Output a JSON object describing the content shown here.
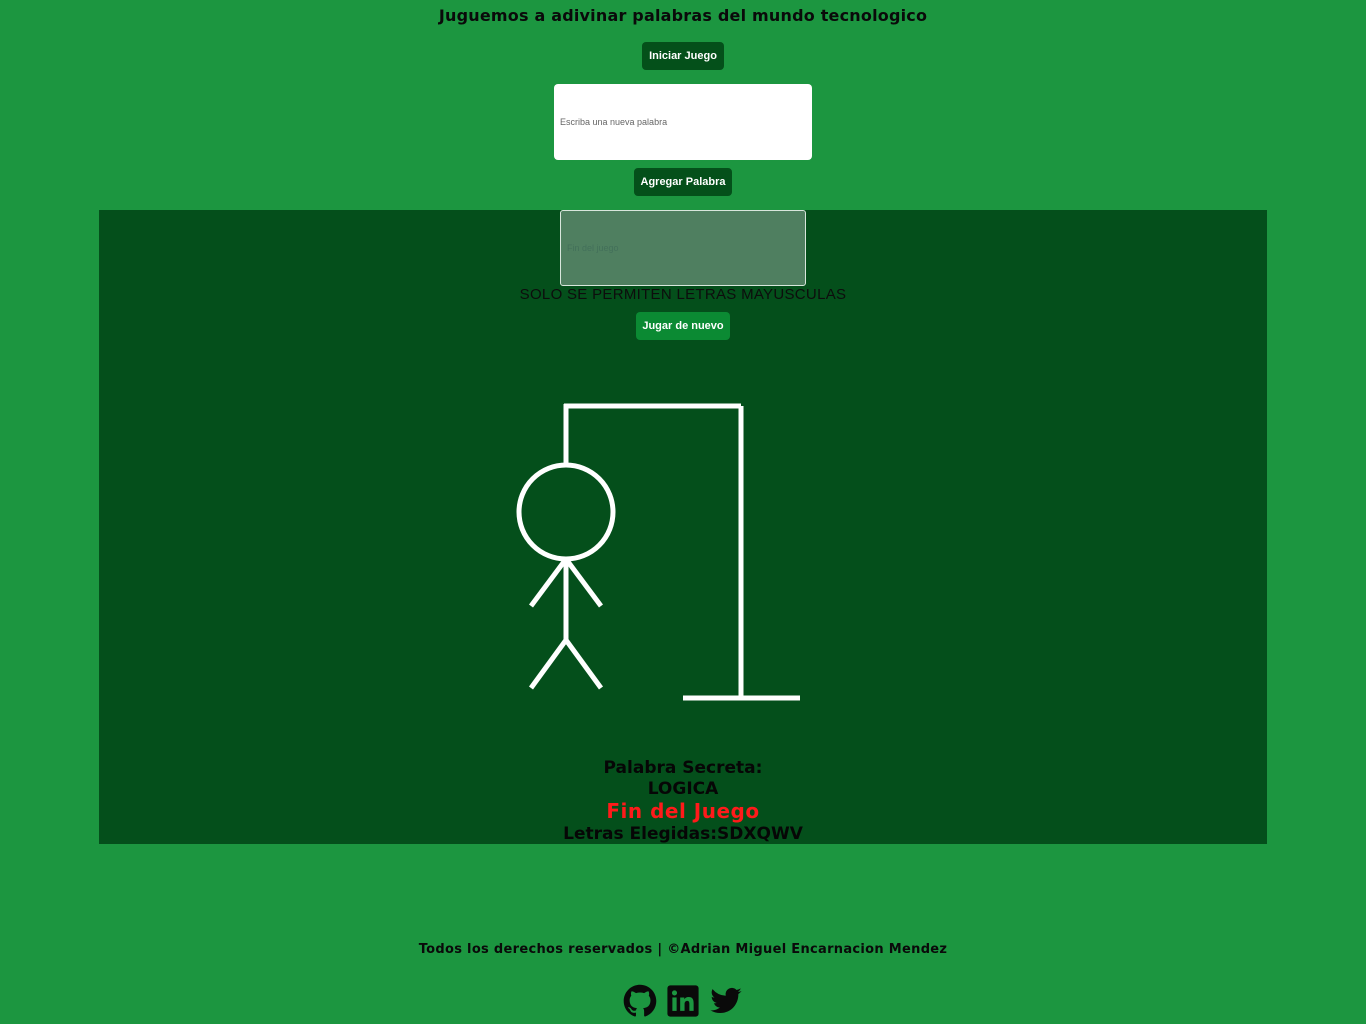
{
  "header": {
    "title": "Juguemos a adivinar palabras del mundo tecnologico"
  },
  "controls": {
    "start_label": "Iniciar Juego",
    "word_input_placeholder": "Escriba una nueva palabra",
    "add_label": "Agregar Palabra"
  },
  "game": {
    "letter_input_placeholder": "Fin del juego",
    "rule_note": "SOLO SE PERMITEN LETRAS MAYUSCULAS",
    "replay_label": "Jugar de nuevo",
    "secret_label": "Palabra Secreta:",
    "secret_word": "LOGICA",
    "status": "Fin del Juego",
    "chosen_letters": "Letras Elegidas:SDXQWV"
  },
  "footer": {
    "text": "Todos los derechos reservados | ©Adrian Miguel Encarnacion Mendez",
    "icons": [
      "github-icon",
      "linkedin-icon",
      "twitter-icon"
    ]
  },
  "colors": {
    "background": "#1c9640",
    "panel": "#044f1b",
    "button_dark": "#04501a",
    "button_mid": "#0b8a33",
    "status": "#ff1a1a",
    "drawing": "#ffffff"
  }
}
